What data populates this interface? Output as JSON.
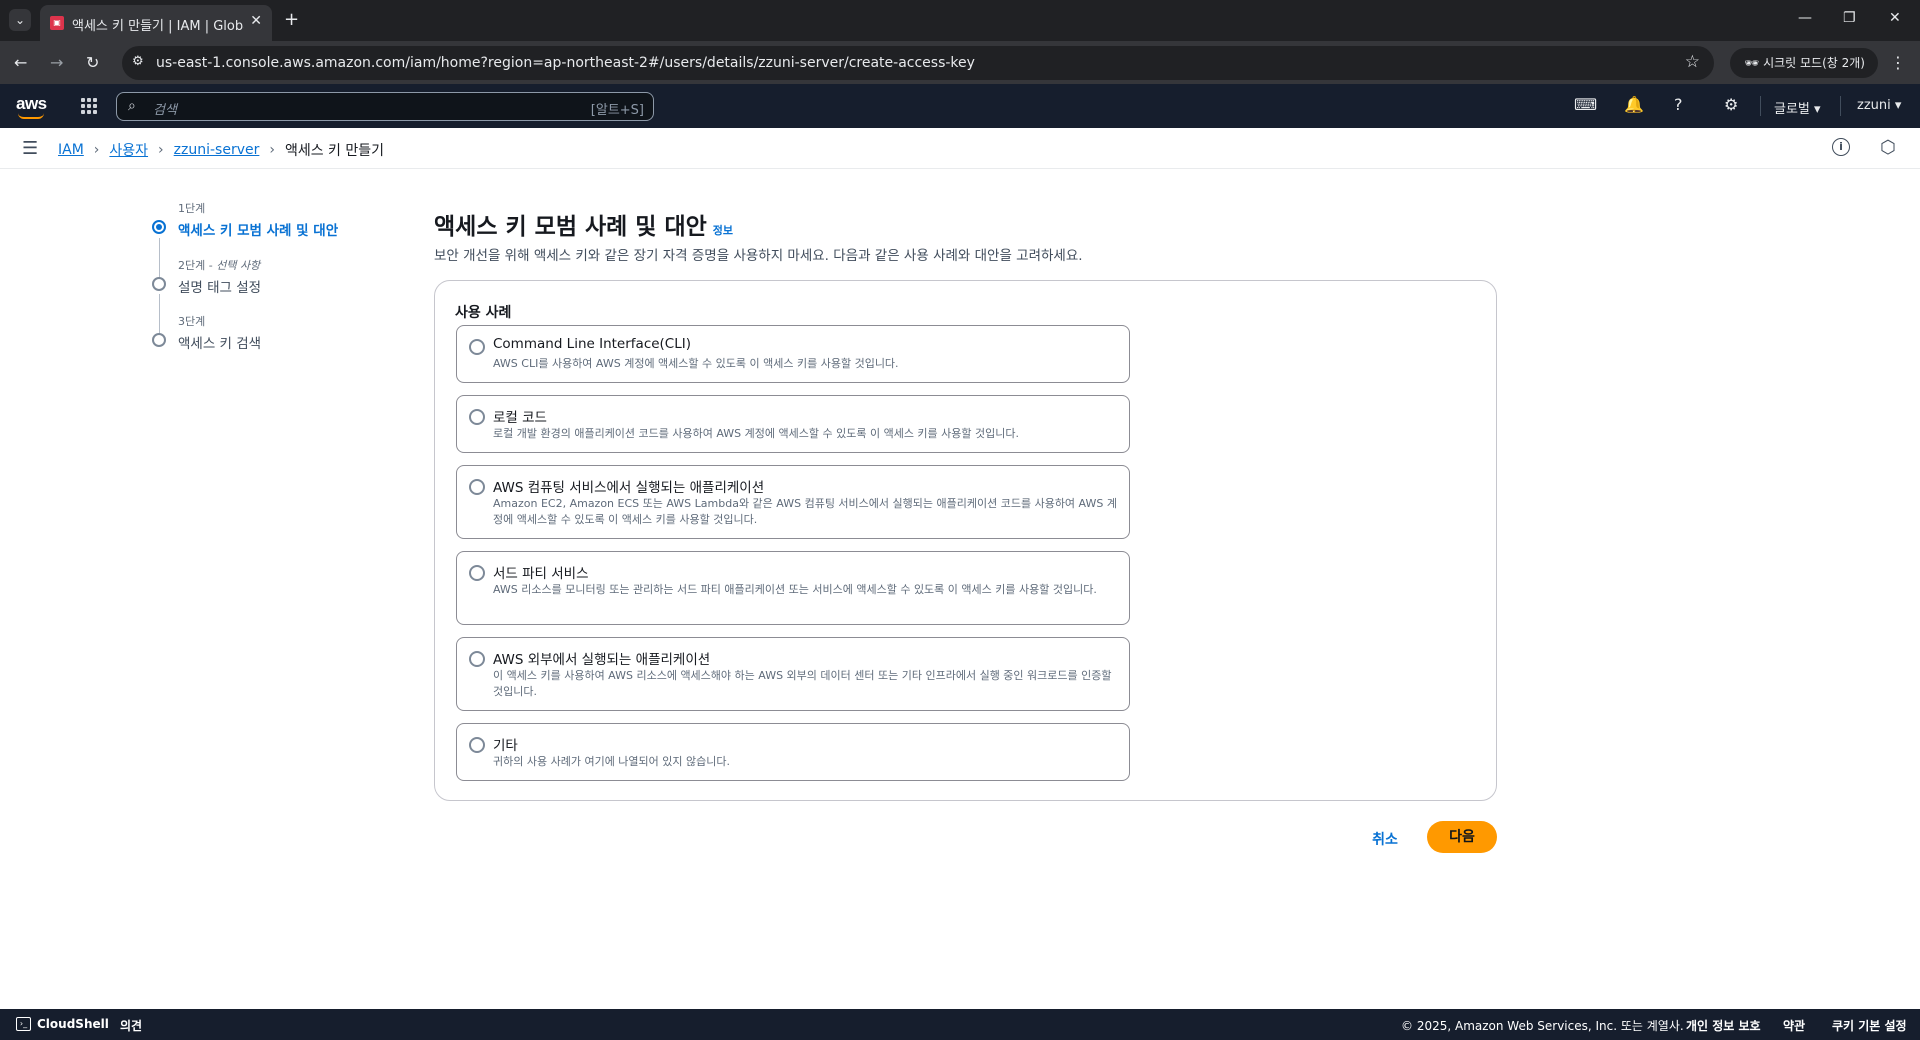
{
  "browser": {
    "tab_title": "액세스 키 만들기 | IAM | Global",
    "tab_close": "✕",
    "new_tab": "+",
    "url": "us-east-1.console.aws.amazon.com/iam/home?region=ap-northeast-2#/users/details/zzuni-server/create-access-key",
    "incognito_label": "시크릿 모드(창 2개)"
  },
  "aws_nav": {
    "logo": "aws",
    "search_placeholder": "검색",
    "search_shortcut": "[알트+S]",
    "region": "글로벌 ▾",
    "account": "zzuni ▾"
  },
  "breadcrumb": {
    "items": [
      "IAM",
      "사용자",
      "zzuni-server"
    ],
    "current": "액세스 키 만들기"
  },
  "steps": [
    {
      "num": "1단계",
      "optional": "",
      "label": "액세스 키 모범 사례 및 대안",
      "active": true
    },
    {
      "num": "2단계 - ",
      "optional": "선택 사항",
      "label": "설명 태그 설정",
      "active": false
    },
    {
      "num": "3단계",
      "optional": "",
      "label": "액세스 키 검색",
      "active": false
    }
  ],
  "main": {
    "title": "액세스 키 모범 사례 및 대안",
    "info_link": "정보",
    "description": "보안 개선을 위해 액세스 키와 같은 장기 자격 증명을 사용하지 마세요. 다음과 같은 사용 사례와 대안을 고려하세요.",
    "section_title": "사용 사례",
    "options": [
      {
        "title": "Command Line Interface(CLI)",
        "desc": "AWS CLI를 사용하여 AWS 계정에 액세스할 수 있도록 이 액세스 키를 사용할 것입니다."
      },
      {
        "title": "로컬 코드",
        "desc": "로컬 개발 환경의 애플리케이션 코드를 사용하여 AWS 계정에 액세스할 수 있도록 이 액세스 키를 사용할 것입니다."
      },
      {
        "title": "AWS 컴퓨팅 서비스에서 실행되는 애플리케이션",
        "desc": "Amazon EC2, Amazon ECS 또는 AWS Lambda와 같은 AWS 컴퓨팅 서비스에서 실행되는 애플리케이션 코드를 사용하여 AWS 계정에 액세스할 수 있도록 이 액세스 키를 사용할 것입니다."
      },
      {
        "title": "서드 파티 서비스",
        "desc": "AWS 리소스를 모니터링 또는 관리하는 서드 파티 애플리케이션 또는 서비스에 액세스할 수 있도록 이 액세스 키를 사용할 것입니다."
      },
      {
        "title": "AWS 외부에서 실행되는 애플리케이션",
        "desc": "이 액세스 키를 사용하여 AWS 리소스에 액세스해야 하는 AWS 외부의 데이터 센터 또는 기타 인프라에서 실행 중인 워크로드를 인증할 것입니다."
      },
      {
        "title": "기타",
        "desc": "귀하의 사용 사례가 여기에 나열되어 있지 않습니다."
      }
    ],
    "cancel_label": "취소",
    "next_label": "다음"
  },
  "footer": {
    "cloudshell": "CloudShell",
    "feedback": "의견",
    "copyright": "© 2025, Amazon Web Services, Inc. 또는 계열사.",
    "privacy": "개인 정보 보호",
    "terms": "약관",
    "cookies": "쿠키 기본 설정"
  },
  "colors": {
    "accent": "#0972d3",
    "primary_button": "#ff9900",
    "nav_bg": "#161e2d"
  }
}
